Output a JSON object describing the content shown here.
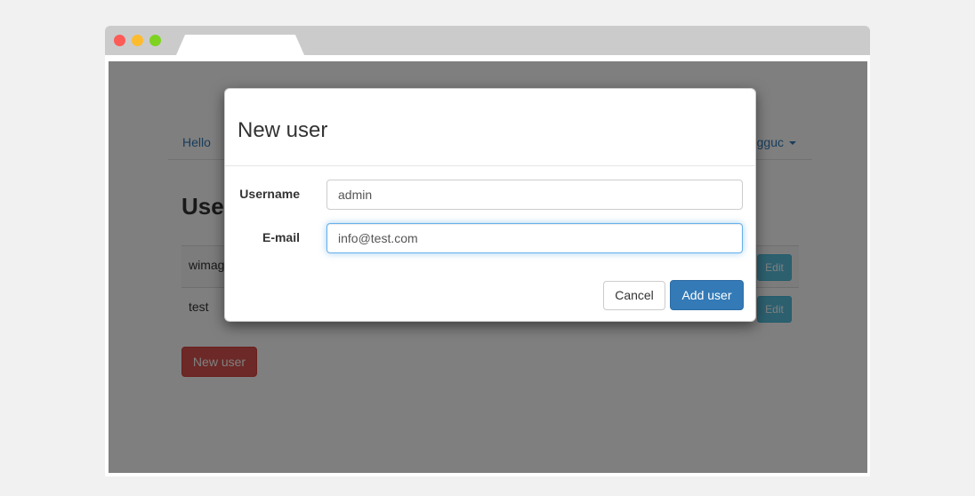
{
  "page": {
    "nav_brand": "Hello",
    "nav_user": "gguc",
    "heading": "User",
    "users": [
      {
        "name": "wimag",
        "edit_label": "Edit"
      },
      {
        "name": "test",
        "edit_label": "Edit"
      }
    ],
    "new_user_button": "New user"
  },
  "modal": {
    "title": "New user",
    "fields": {
      "username": {
        "label": "Username",
        "value": "admin"
      },
      "email": {
        "label": "E-mail",
        "value": "info@test.com"
      }
    },
    "cancel_label": "Cancel",
    "submit_label": "Add user"
  },
  "colors": {
    "primary": "#337ab7",
    "danger": "#d9534f",
    "info": "#5bc0de",
    "backdrop": "rgba(0,0,0,0.5)"
  }
}
